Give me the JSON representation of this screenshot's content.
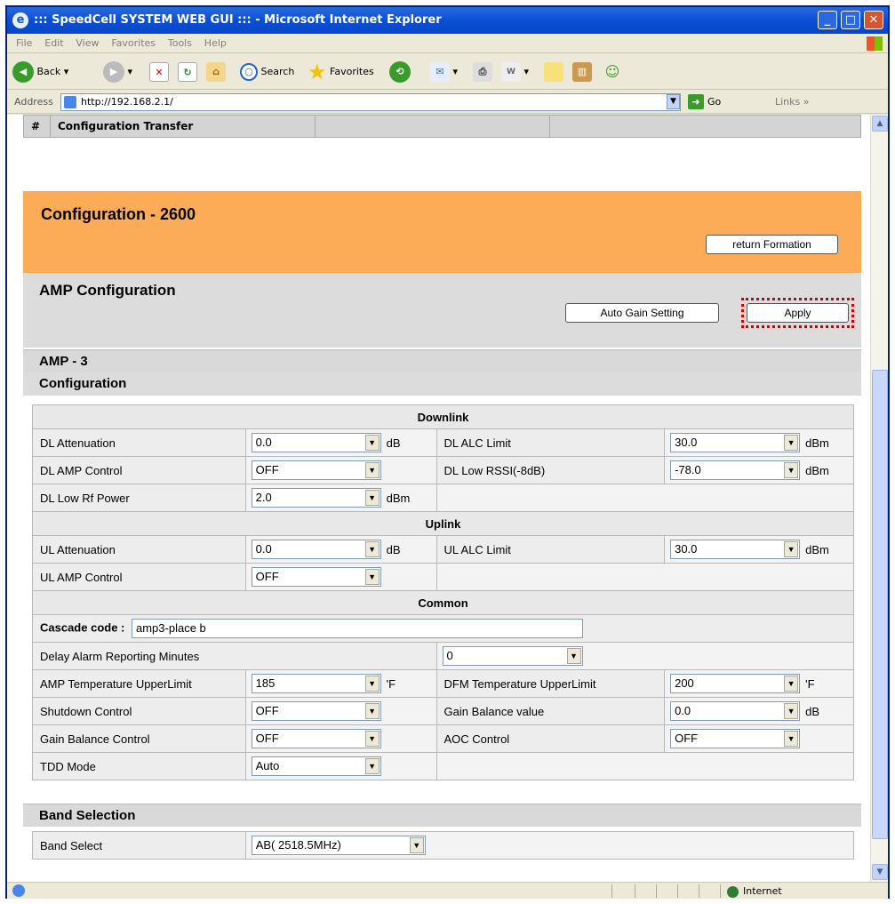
{
  "window": {
    "title": "::: SpeedCell SYSTEM WEB GUI ::: - Microsoft Internet Explorer"
  },
  "menu": [
    "File",
    "Edit",
    "View",
    "Favorites",
    "Tools",
    "Help"
  ],
  "toolbar": {
    "back": "Back",
    "search": "Search",
    "favorites": "Favorites"
  },
  "address": {
    "label": "Address",
    "url": "http://192.168.2.1/",
    "go": "Go",
    "links": "Links"
  },
  "tabstrip": {
    "hash": "#",
    "label": "Configuration Transfer"
  },
  "header": {
    "title": "Configuration - 2600",
    "return_button": "return Formation"
  },
  "amp_config": {
    "title": "AMP Configuration",
    "auto_gain_button": "Auto Gain Setting",
    "apply_button": "Apply"
  },
  "amp_section": "AMP - 3",
  "configuration_section": "Configuration",
  "downlink": {
    "header": "Downlink",
    "dl_attenuation": {
      "label": "DL Attenuation",
      "value": "0.0",
      "unit": "dB"
    },
    "dl_alc_limit": {
      "label": "DL ALC Limit",
      "value": "30.0",
      "unit": "dBm"
    },
    "dl_amp_control": {
      "label": "DL AMP Control",
      "value": "OFF"
    },
    "dl_low_rssi": {
      "label": "DL Low RSSI(-8dB)",
      "value": "-78.0",
      "unit": "dBm"
    },
    "dl_low_rf_power": {
      "label": "DL Low Rf Power",
      "value": "2.0",
      "unit": "dBm"
    }
  },
  "uplink": {
    "header": "Uplink",
    "ul_attenuation": {
      "label": "UL Attenuation",
      "value": "0.0",
      "unit": "dB"
    },
    "ul_alc_limit": {
      "label": "UL ALC Limit",
      "value": "30.0",
      "unit": "dBm"
    },
    "ul_amp_control": {
      "label": "UL AMP Control",
      "value": "OFF"
    }
  },
  "common": {
    "header": "Common",
    "cascade_code": {
      "label": "Cascade code :",
      "value": "amp3-place b"
    },
    "delay_alarm": {
      "label": "Delay Alarm Reporting Minutes",
      "value": "0"
    },
    "amp_temp": {
      "label": "AMP Temperature UpperLimit",
      "value": "185",
      "unit": "'F"
    },
    "dfm_temp": {
      "label": "DFM Temperature UpperLimit",
      "value": "200",
      "unit": "'F"
    },
    "shutdown": {
      "label": "Shutdown Control",
      "value": "OFF"
    },
    "gain_balance_value": {
      "label": "Gain Balance value",
      "value": "0.0",
      "unit": "dB"
    },
    "gain_balance_control": {
      "label": "Gain Balance Control",
      "value": "OFF"
    },
    "aoc_control": {
      "label": "AOC Control",
      "value": "OFF"
    },
    "tdd_mode": {
      "label": "TDD Mode",
      "value": "Auto"
    }
  },
  "band_section": "Band Selection",
  "band": {
    "label": "Band Select",
    "value": "AB( 2518.5MHz)"
  },
  "status": {
    "zone": "Internet"
  },
  "colors": {
    "header_orange": "#fcac57",
    "titlebar_blue": "#0a4fd4",
    "highlight_red": "#d40000"
  }
}
